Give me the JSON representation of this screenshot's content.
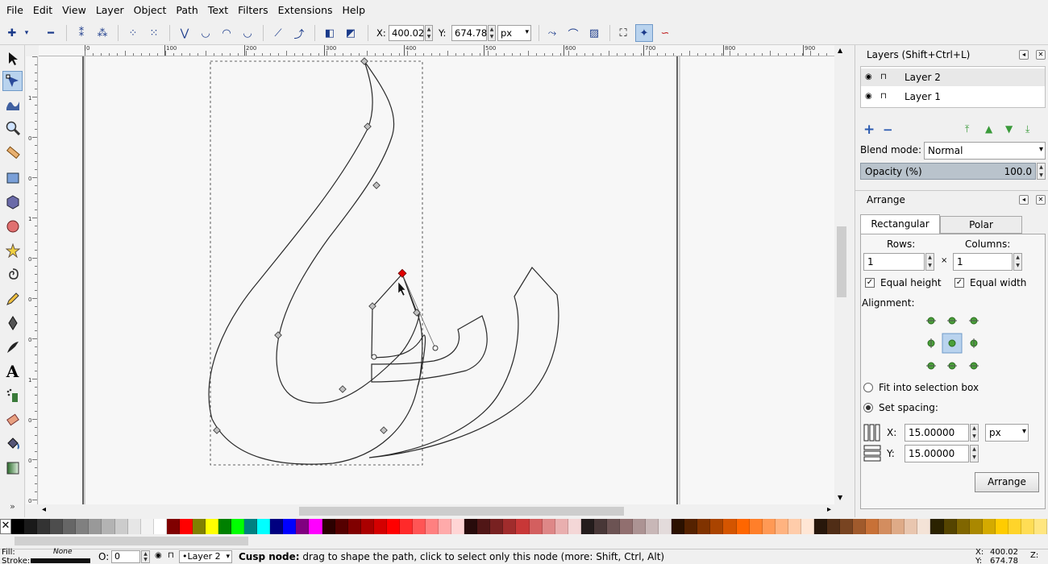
{
  "menu": [
    "File",
    "Edit",
    "View",
    "Layer",
    "Object",
    "Path",
    "Text",
    "Filters",
    "Extensions",
    "Help"
  ],
  "toolbar": {
    "x_label": "X:",
    "x_value": "400.020",
    "y_label": "Y:",
    "y_value": "674.782",
    "unit": "px"
  },
  "ruler": {
    "h_ticks": [
      "0",
      "100",
      "200",
      "300",
      "400",
      "500",
      "600",
      "700",
      "800",
      "900"
    ],
    "v_ticks": [
      "1",
      "0",
      "0",
      "1",
      "0",
      "0",
      "0",
      "1",
      "0",
      "0",
      "0"
    ]
  },
  "layers_panel": {
    "title": "Layers (Shift+Ctrl+L)",
    "layers": [
      {
        "name": "Layer 2",
        "selected": true
      },
      {
        "name": "Layer 1",
        "selected": false
      }
    ],
    "blend_label": "Blend mode:",
    "blend_value": "Normal",
    "opacity_label": "Opacity (%)",
    "opacity_value": "100.0"
  },
  "arrange_panel": {
    "title": "Arrange",
    "tab_rect": "Rectangular grid",
    "tab_polar": "Polar Coordinates",
    "rows_label": "Rows:",
    "rows_value": "1",
    "cols_label": "Columns:",
    "cols_value": "1",
    "times": "×",
    "equal_height": "Equal height",
    "equal_width": "Equal width",
    "alignment_label": "Alignment:",
    "fit_label": "Fit into selection box",
    "spacing_label": "Set spacing:",
    "x_label": "X:",
    "x_value": "15.00000",
    "y_label": "Y:",
    "y_value": "15.00000",
    "unit": "px",
    "arrange_button": "Arrange"
  },
  "palette": {
    "colors": [
      "#000000",
      "#1a1a1a",
      "#333333",
      "#4d4d4d",
      "#666666",
      "#808080",
      "#999999",
      "#b3b3b3",
      "#cccccc",
      "#e6e6e6",
      "#f2f2f2",
      "#ffffff",
      "#800000",
      "#ff0000",
      "#808000",
      "#ffff00",
      "#008000",
      "#00ff00",
      "#008080",
      "#00ffff",
      "#000080",
      "#0000ff",
      "#800080",
      "#ff00ff",
      "#2b0000",
      "#550000",
      "#800000",
      "#aa0000",
      "#d40000",
      "#ff0000",
      "#ff2a2a",
      "#ff5555",
      "#ff8080",
      "#ffaaaa",
      "#ffd5d5",
      "#280b0b",
      "#501616",
      "#782121",
      "#a02c2c",
      "#c83737",
      "#d35f5f",
      "#de8787",
      "#e9afaf",
      "#f4d7d7",
      "#241c1c",
      "#483737",
      "#6c5353",
      "#916f6f",
      "#ac9393",
      "#c8b7b7",
      "#e3dbdb",
      "#2b1100",
      "#552200",
      "#803300",
      "#aa4400",
      "#d45500",
      "#ff6600",
      "#ff7f2a",
      "#ff9955",
      "#ffb380",
      "#ffccaa",
      "#ffe6d5",
      "#28170b",
      "#502d16",
      "#784421",
      "#a05a2c",
      "#c87137",
      "#d38d5f",
      "#deaa87",
      "#e9c6af",
      "#f4e3d7",
      "#2b2200",
      "#554400",
      "#806600",
      "#aa8800",
      "#d4aa00",
      "#ffcc00",
      "#ffd42a",
      "#ffdd55",
      "#ffe680"
    ]
  },
  "status": {
    "fill_label": "Fill:",
    "fill_value": "None",
    "stroke_label": "Stroke:",
    "o_label": "O:",
    "o_value": "0",
    "layer_value": "•Layer 2",
    "message_bold": "Cusp node:",
    "message": " drag to shape the path, click to select only this node (more: Shift, Ctrl, Alt)",
    "cursor_x_label": "X:",
    "cursor_x": "400.02",
    "cursor_y_label": "Y:",
    "cursor_y": "674.78",
    "zoom_label": "Z:"
  }
}
